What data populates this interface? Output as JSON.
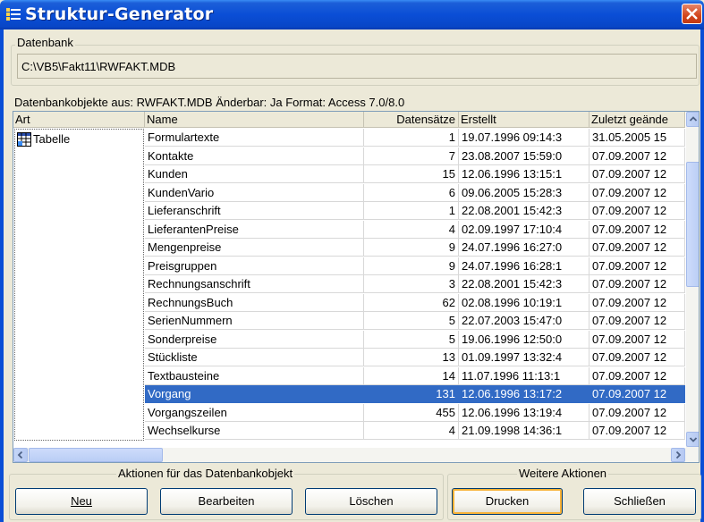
{
  "window": {
    "title": "Struktur-Generator"
  },
  "database": {
    "group_label": "Datenbank",
    "path": "C:\\VB5\\Fakt11\\RWFAKT.MDB"
  },
  "info_line": "Datenbankobjekte aus: RWFAKT.MDB  Änderbar: Ja  Format: Access 7.0/8.0",
  "list": {
    "headers": {
      "art": "Art",
      "name": "Name",
      "datensaetze": "Datensätze",
      "erstellt": "Erstellt",
      "zuletzt": "Zuletzt geände"
    },
    "art_items": [
      {
        "label": "Tabelle",
        "icon": "table-icon"
      }
    ],
    "rows": [
      {
        "name": "Formulartexte",
        "count": "1",
        "created": "19.07.1996 09:14:3",
        "modified": "31.05.2005 15"
      },
      {
        "name": "Kontakte",
        "count": "7",
        "created": "23.08.2007 15:59:0",
        "modified": "07.09.2007 12"
      },
      {
        "name": "Kunden",
        "count": "15",
        "created": "12.06.1996 13:15:1",
        "modified": "07.09.2007 12"
      },
      {
        "name": "KundenVario",
        "count": "6",
        "created": "09.06.2005 15:28:3",
        "modified": "07.09.2007 12"
      },
      {
        "name": "Lieferanschrift",
        "count": "1",
        "created": "22.08.2001 15:42:3",
        "modified": "07.09.2007 12"
      },
      {
        "name": "LieferantenPreise",
        "count": "4",
        "created": "02.09.1997 17:10:4",
        "modified": "07.09.2007 12"
      },
      {
        "name": "Mengenpreise",
        "count": "9",
        "created": "24.07.1996 16:27:0",
        "modified": "07.09.2007 12"
      },
      {
        "name": "Preisgruppen",
        "count": "9",
        "created": "24.07.1996 16:28:1",
        "modified": "07.09.2007 12"
      },
      {
        "name": "Rechnungsanschrift",
        "count": "3",
        "created": "22.08.2001 15:42:3",
        "modified": "07.09.2007 12"
      },
      {
        "name": "RechnungsBuch",
        "count": "62",
        "created": "02.08.1996 10:19:1",
        "modified": "07.09.2007 12"
      },
      {
        "name": "SerienNummern",
        "count": "5",
        "created": "22.07.2003 15:47:0",
        "modified": "07.09.2007 12"
      },
      {
        "name": "Sonderpreise",
        "count": "5",
        "created": "19.06.1996 12:50:0",
        "modified": "07.09.2007 12"
      },
      {
        "name": "Stückliste",
        "count": "13",
        "created": "01.09.1997 13:32:4",
        "modified": "07.09.2007 12"
      },
      {
        "name": "Textbausteine",
        "count": "14",
        "created": "11.07.1996 11:13:1",
        "modified": "07.09.2007 12"
      },
      {
        "name": "Vorgang",
        "count": "131",
        "created": "12.06.1996 13:17:2",
        "modified": "07.09.2007 12",
        "selected": true
      },
      {
        "name": "Vorgangszeilen",
        "count": "455",
        "created": "12.06.1996 13:19:4",
        "modified": "07.09.2007 12"
      },
      {
        "name": "Wechselkurse",
        "count": "4",
        "created": "21.09.1998 14:36:1",
        "modified": "07.09.2007 12"
      }
    ]
  },
  "actions": {
    "group_label": "Aktionen für das Datenbankobjekt",
    "new": "Neu",
    "edit": "Bearbeiten",
    "delete": "Löschen"
  },
  "more_actions": {
    "group_label": "Weitere Aktionen",
    "print": "Drucken",
    "close": "Schließen"
  },
  "colors": {
    "titlebar": "#0a4ed6",
    "selection": "#316ac5",
    "dialog": "#ece9d8"
  }
}
